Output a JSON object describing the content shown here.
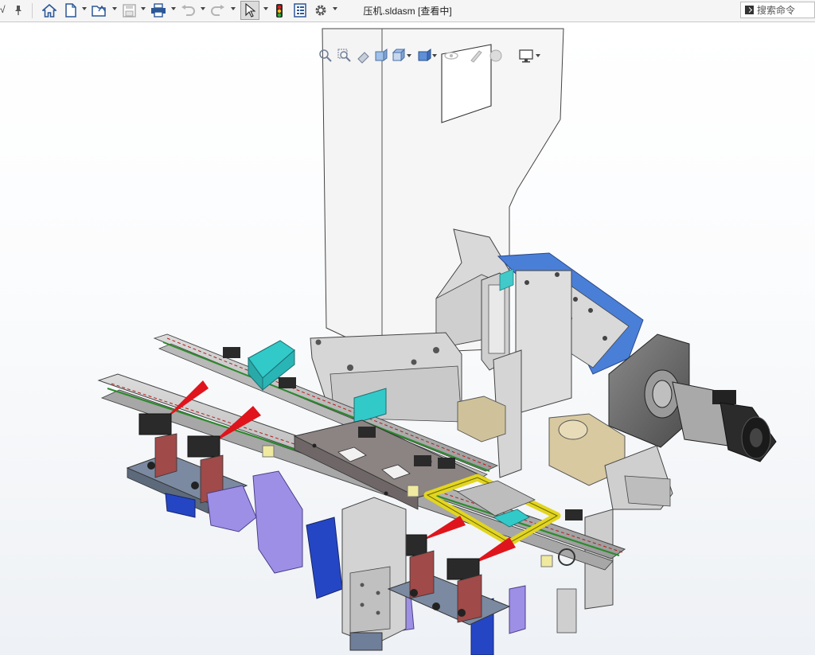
{
  "window": {
    "document_title": "压机.sldasm [查看中]",
    "left_edge_glyph": "√"
  },
  "toolbar": {
    "items": [
      {
        "name": "pin-icon"
      },
      {
        "name": "home-icon"
      },
      {
        "name": "new-document-icon"
      },
      {
        "name": "open-folder-icon"
      },
      {
        "name": "save-icon"
      },
      {
        "name": "print-icon"
      },
      {
        "name": "undo-icon"
      },
      {
        "name": "redo-icon"
      },
      {
        "name": "select-cursor-icon"
      },
      {
        "name": "rebuild-traffic-light-icon"
      },
      {
        "name": "file-properties-icon"
      },
      {
        "name": "options-gear-icon"
      }
    ]
  },
  "command_search": {
    "placeholder": "搜索命令"
  },
  "heads_up_toolbar": {
    "items": [
      "zoom-to-fit-icon",
      "zoom-to-area-icon",
      "previous-view-icon",
      "section-view-icon",
      "view-orientation-icon",
      "display-style-icon",
      "hide-show-items-icon",
      "edit-appearance-icon",
      "apply-scene-icon",
      "view-settings-icon"
    ]
  },
  "colors": {
    "titlebar": "#f5f5f5",
    "toolbar_icon_blue": "#2b5797",
    "frame_gray": "#d4d4d4",
    "press_white": "#f3f3f3",
    "accent_purple": "#9e8fe6",
    "accent_blue": "#2546c4",
    "accent_cyan": "#32c9c9",
    "accent_yellow": "#e2d520",
    "sensor_red": "#e0141c",
    "motor_plate_blue": "#4a7fd8",
    "background_bottom": "#eef1f5"
  }
}
